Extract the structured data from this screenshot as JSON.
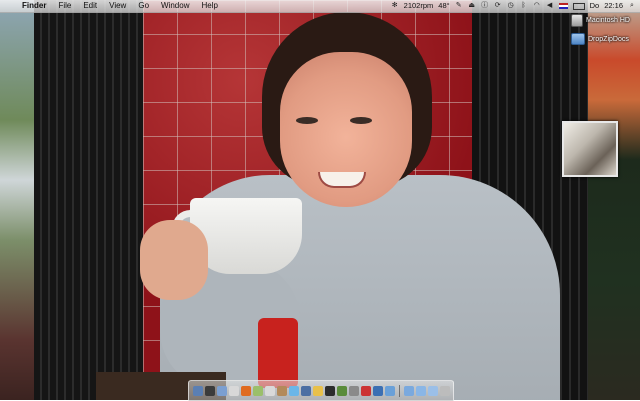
{
  "menubar": {
    "apple_icon": "apple-icon",
    "app_name": "Finder",
    "menus": [
      "File",
      "Edit",
      "View",
      "Go",
      "Window",
      "Help"
    ],
    "status": {
      "rpm": "2102rpm",
      "temperature": "48°",
      "day": "Do",
      "time": "22:16"
    }
  },
  "desktop_icons": [
    {
      "label": "Macintosh HD",
      "icon": "hard-drive-icon"
    },
    {
      "label": "DropZipDocs",
      "icon": "folder-icon"
    }
  ],
  "dock": {
    "items": [
      "finder-icon",
      "dashboard-icon",
      "mail-icon",
      "safari-icon",
      "firefox-icon",
      "ichat-icon",
      "calendar-icon",
      "addressbook-icon",
      "itunes-icon",
      "iphoto-icon",
      "preview-icon",
      "terminal-icon",
      "activity-monitor-icon",
      "system-preferences-icon",
      "app-icon",
      "app-icon-2",
      "network-icon",
      "folder-icon",
      "downloads-icon",
      "documents-icon",
      "trash-icon"
    ],
    "colors": [
      "#5b7fb3",
      "#3b3b3b",
      "#7b9fd1",
      "#d8d8d8",
      "#e06b1f",
      "#9bbf6a",
      "#d9d9d9",
      "#b38a5a",
      "#6bb6e8",
      "#4c6fa3",
      "#e8c04a",
      "#2c2c2c",
      "#5a8c3a",
      "#8a8a8a",
      "#c33",
      "#3b6fb3",
      "#6aa0d8",
      "#7aa9de",
      "#8ab6e6",
      "#9bbfe8",
      "#bcbcbc"
    ]
  }
}
